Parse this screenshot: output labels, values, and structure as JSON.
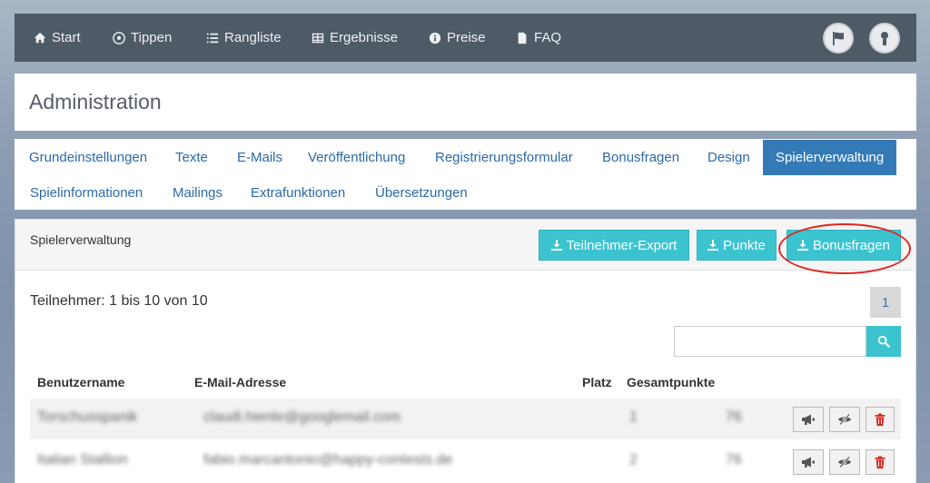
{
  "nav": {
    "items": [
      {
        "label": "Start",
        "icon": "home-icon"
      },
      {
        "label": "Tippen",
        "icon": "soccer-ball-icon"
      },
      {
        "label": "Rangliste",
        "icon": "list-icon"
      },
      {
        "label": "Ergebnisse",
        "icon": "table-icon"
      },
      {
        "label": "Preise",
        "icon": "info-icon"
      },
      {
        "label": "FAQ",
        "icon": "file-icon"
      }
    ]
  },
  "page": {
    "title": "Administration"
  },
  "tabs": [
    {
      "label": "Grundeinstellungen"
    },
    {
      "label": "Texte"
    },
    {
      "label": "E-Mails"
    },
    {
      "label": "Veröffentlichung"
    },
    {
      "label": "Registrierungsformular"
    },
    {
      "label": "Bonusfragen"
    },
    {
      "label": "Design"
    },
    {
      "label": "Spielerverwaltung",
      "active": true
    },
    {
      "label": "Spielinformationen"
    },
    {
      "label": "Mailings"
    },
    {
      "label": "Extrafunktionen"
    },
    {
      "label": "Übersetzungen"
    }
  ],
  "panel": {
    "heading": "Spielerverwaltung",
    "buttons": {
      "export": "Teilnehmer-Export",
      "points": "Punkte",
      "bonus": "Bonusfragen"
    },
    "count_text": "Teilnehmer: 1 bis 10 von 10",
    "page_number": "1",
    "search": {
      "value": "",
      "placeholder": ""
    }
  },
  "table": {
    "headers": {
      "username": "Benutzername",
      "email": "E-Mail-Adresse",
      "place": "Platz",
      "points": "Gesamtpunkte"
    },
    "rows": [
      {
        "username": "Torschusspanik",
        "email": "claudi.hienle@googlemail.com",
        "place": "1",
        "points": "76"
      },
      {
        "username": "Italian Stallion",
        "email": "fabio.marcantonio@happy-contests.de",
        "place": "2",
        "points": "76"
      }
    ]
  },
  "colors": {
    "navbar": "#4f5a67",
    "accent": "#3cc3d0",
    "active_tab": "#337ab7",
    "link": "#2a6aa8",
    "danger": "#d9261c",
    "highlight": "#e0261f"
  }
}
